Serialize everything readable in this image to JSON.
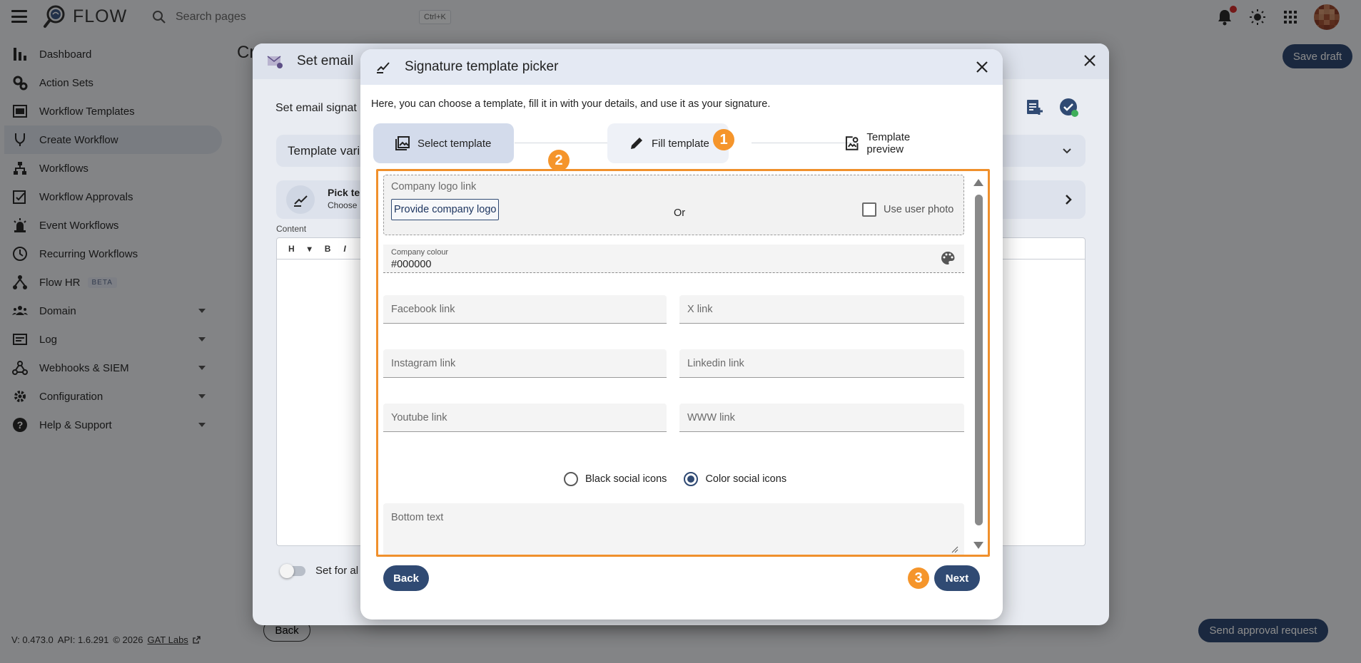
{
  "app": {
    "name": "FLOW"
  },
  "search": {
    "placeholder": "Search pages",
    "shortcut": "Ctrl+K"
  },
  "sidebar": {
    "items": [
      {
        "label": "Dashboard"
      },
      {
        "label": "Action Sets"
      },
      {
        "label": "Workflow Templates"
      },
      {
        "label": "Create Workflow"
      },
      {
        "label": "Workflows"
      },
      {
        "label": "Workflow Approvals"
      },
      {
        "label": "Event Workflows"
      },
      {
        "label": "Recurring Workflows"
      },
      {
        "label": "Flow HR",
        "badge": "BETA"
      },
      {
        "label": "Domain"
      },
      {
        "label": "Log"
      },
      {
        "label": "Webhooks & SIEM"
      },
      {
        "label": "Configuration"
      },
      {
        "label": "Help & Support"
      }
    ]
  },
  "footer": {
    "version": "V: 0.473.0",
    "api": "API: 1.6.291",
    "copyright": "© 2026",
    "company_link": "GAT Labs"
  },
  "page": {
    "title_partial": "Cr",
    "save_draft": "Save draft",
    "back": "Back",
    "send_approval": "Send approval request"
  },
  "email_dialog": {
    "title": "Set email",
    "subtitle": "Set email signat",
    "template_variables": "Template vari",
    "pick_title": "Pick te",
    "pick_sub": "Choose",
    "content_label": "Content",
    "toolbar": {
      "heading": "H",
      "bold": "B",
      "italic": "I"
    },
    "toggle_label": "Set for al"
  },
  "picker": {
    "title": "Signature template picker",
    "intro": "Here, you can choose a template, fill it in with your details, and use it as your signature.",
    "steps": [
      {
        "label": "Select template"
      },
      {
        "label": "Fill template"
      },
      {
        "label": "Template preview"
      }
    ],
    "logo": {
      "label": "Company logo link",
      "button": "Provide company logo",
      "or": "Or",
      "use_user_photo": "Use user photo"
    },
    "colour": {
      "label": "Company colour",
      "value": "#000000"
    },
    "fields": {
      "facebook": "Facebook link",
      "x": "X link",
      "instagram": "Instagram link",
      "linkedin": "Linkedin link",
      "youtube": "Youtube link",
      "www": "WWW link"
    },
    "icon_style": {
      "black": "Black social icons",
      "color": "Color social icons",
      "selected": "color"
    },
    "bottom_text": "Bottom text",
    "back": "Back",
    "next": "Next"
  },
  "annotations": {
    "one": "1",
    "two": "2",
    "three": "3"
  },
  "colors": {
    "accent": "#304a73",
    "highlight": "#f0902c",
    "notification": "#d32f2f"
  }
}
